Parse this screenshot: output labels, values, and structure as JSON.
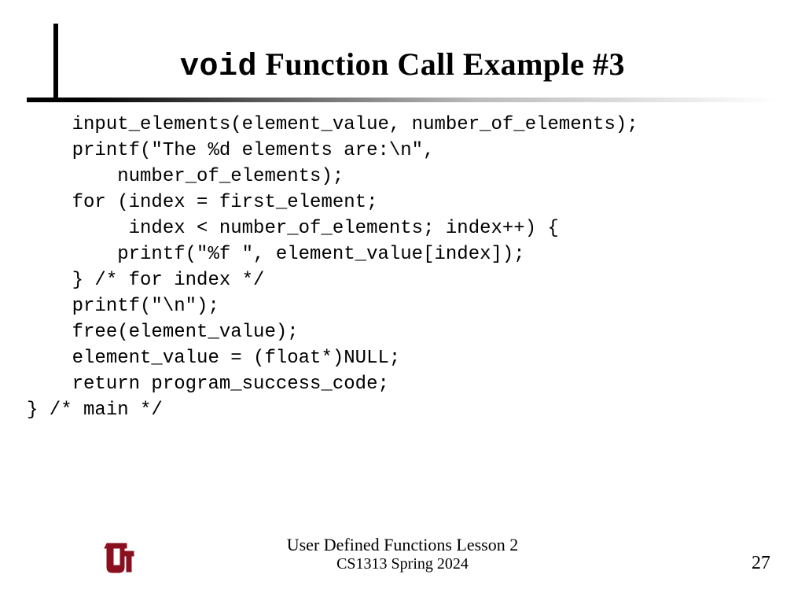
{
  "title": {
    "keyword": "void",
    "rest": " Function Call Example #3"
  },
  "code": "    input_elements(element_value, number_of_elements);\n    printf(\"The %d elements are:\\n\",\n        number_of_elements);\n    for (index = first_element;\n         index < number_of_elements; index++) {\n        printf(\"%f \", element_value[index]);\n    } /* for index */\n    printf(\"\\n\");\n    free(element_value);\n    element_value = (float*)NULL;\n    return program_success_code;\n} /* main */",
  "footer": {
    "line1": "User Defined Functions Lesson 2",
    "line2": "CS1313 Spring 2024",
    "page": "27"
  },
  "logo": {
    "name": "ou-logo",
    "color": "#8a1020"
  }
}
